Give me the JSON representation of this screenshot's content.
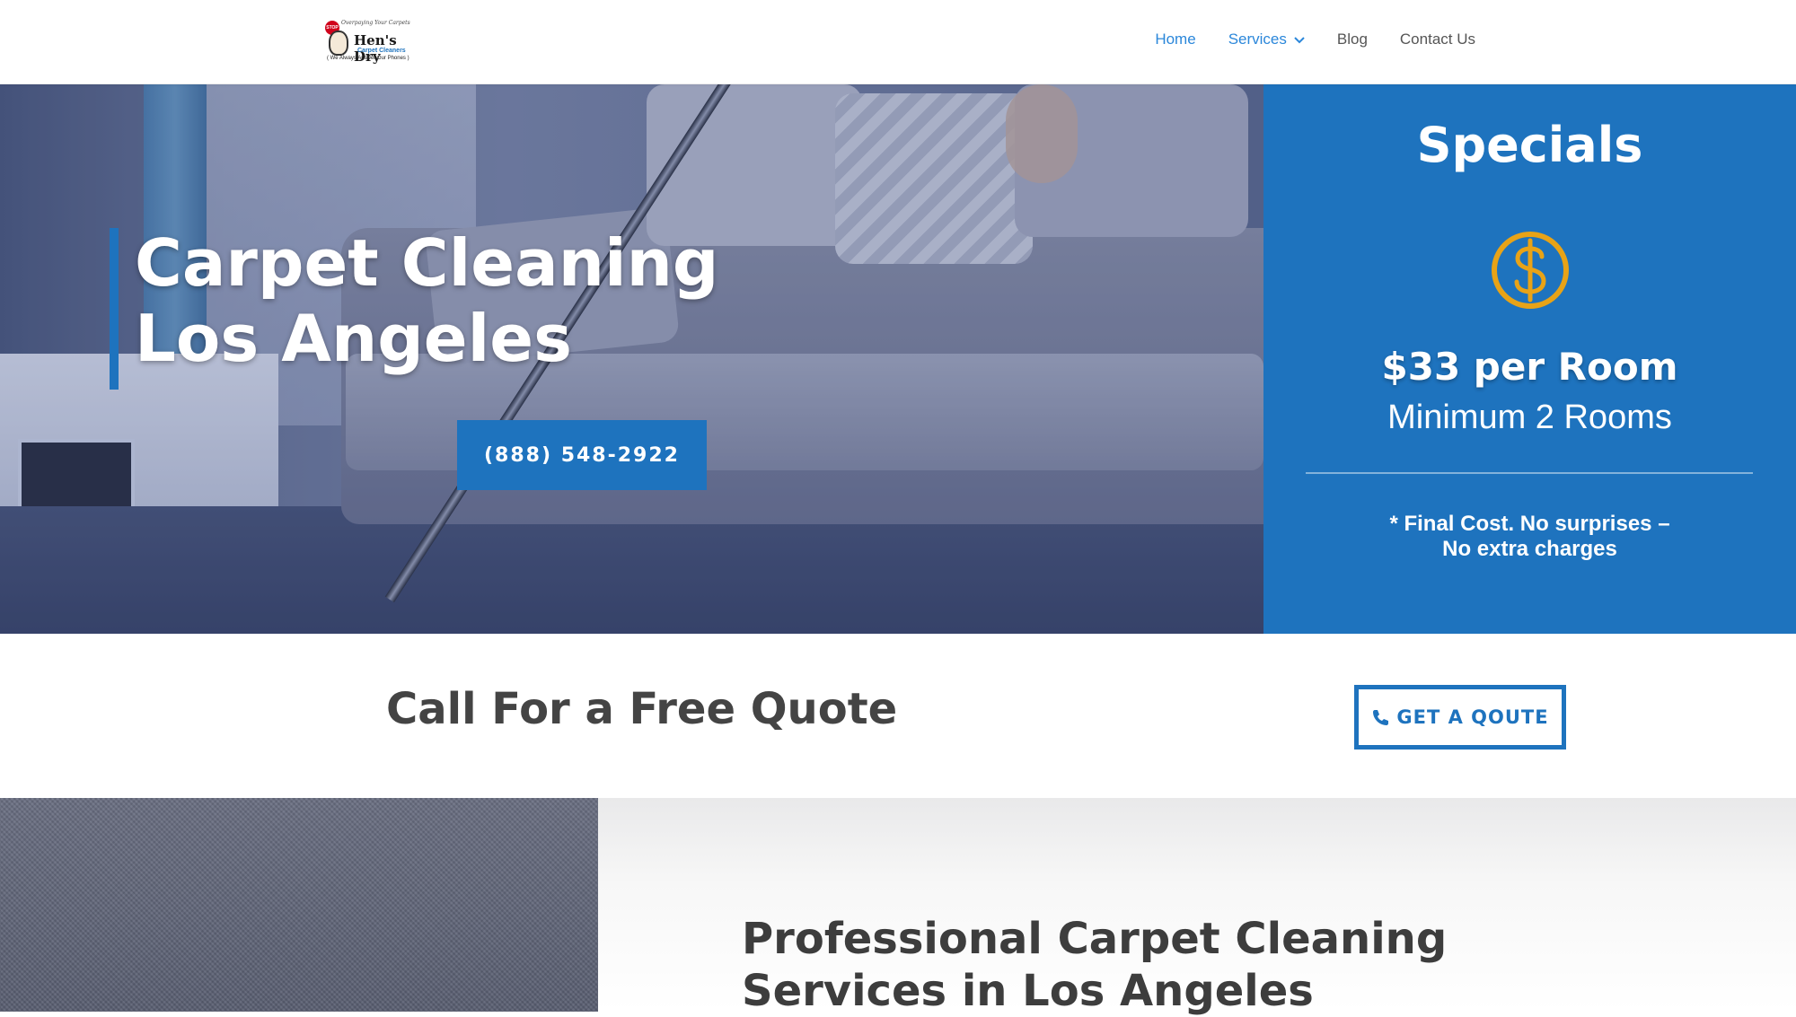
{
  "header": {
    "logo": {
      "badge": "STOP",
      "tagline": "Overpaying Your Carpets",
      "name": "Hen's Dry",
      "subtitle": "Carpet Cleaners",
      "motto": "( We Always Answer Our Phones )"
    },
    "nav": [
      {
        "label": "Home",
        "active": true
      },
      {
        "label": "Services",
        "has_dropdown": true
      },
      {
        "label": "Blog"
      },
      {
        "label": "Contact Us"
      }
    ]
  },
  "hero": {
    "title": "Carpet Cleaning Los Angeles",
    "phone_button": "(888) 548-2922"
  },
  "specials": {
    "title": "Specials",
    "icon": "dollar-coin-icon",
    "price": "$33 per Room",
    "minimum": "Minimum 2 Rooms",
    "note": "* Final Cost. No surprises – No extra charges"
  },
  "cta": {
    "title": "Call For a Free Quote",
    "button": "GET A QOUTE"
  },
  "section": {
    "title": "Professional Carpet Cleaning Services in Los Angeles"
  },
  "colors": {
    "brand_blue": "#1e73be",
    "active_nav": "#2b87da",
    "icon_gold": "#e8a317",
    "heading_gray": "#444444"
  }
}
